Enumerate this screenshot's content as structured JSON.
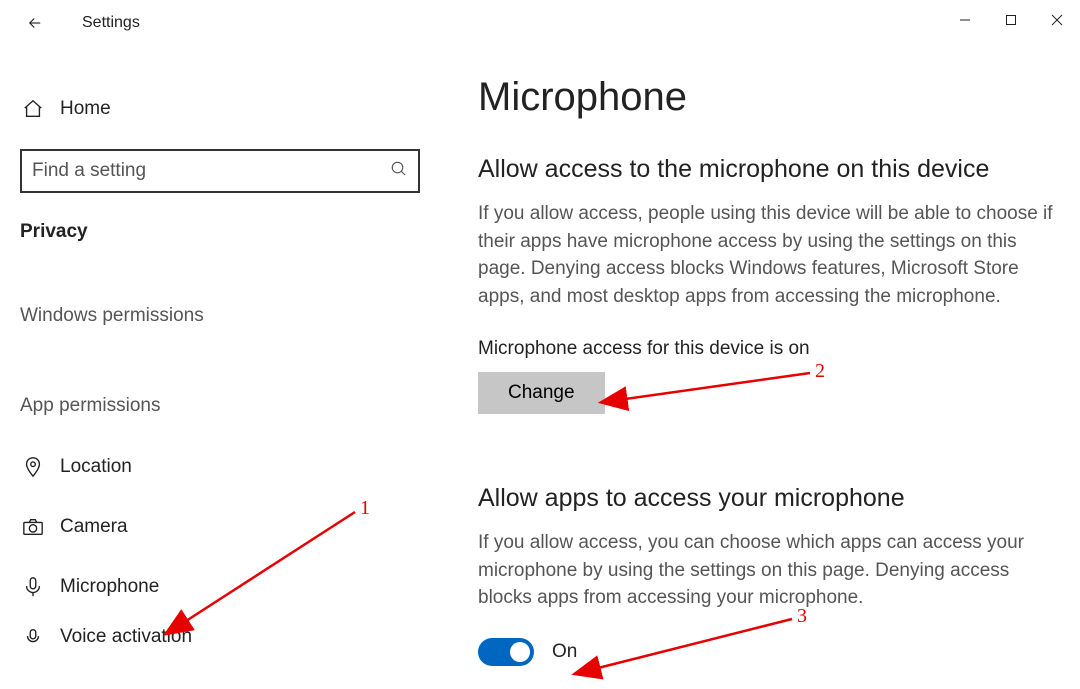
{
  "window": {
    "title": "Settings"
  },
  "sidebar": {
    "home": "Home",
    "search_placeholder": "Find a setting",
    "category": "Privacy",
    "section1": "Windows permissions",
    "section2": "App permissions",
    "items": [
      {
        "label": "Location"
      },
      {
        "label": "Camera"
      },
      {
        "label": "Microphone"
      },
      {
        "label": "Voice activation"
      }
    ]
  },
  "main": {
    "title": "Microphone",
    "sec1": {
      "heading": "Allow access to the microphone on this device",
      "desc": "If you allow access, people using this device will be able to choose if their apps have microphone access by using the settings on this page. Denying access blocks Windows features, Microsoft Store apps, and most desktop apps from accessing the microphone.",
      "status": "Microphone access for this device is on",
      "button": "Change"
    },
    "sec2": {
      "heading": "Allow apps to access your microphone",
      "desc": "If you allow access, you can choose which apps can access your microphone by using the settings on this page. Denying access blocks apps from accessing your microphone.",
      "toggle_label": "On"
    }
  },
  "annotations": {
    "a1": "1",
    "a2": "2",
    "a3": "3"
  }
}
